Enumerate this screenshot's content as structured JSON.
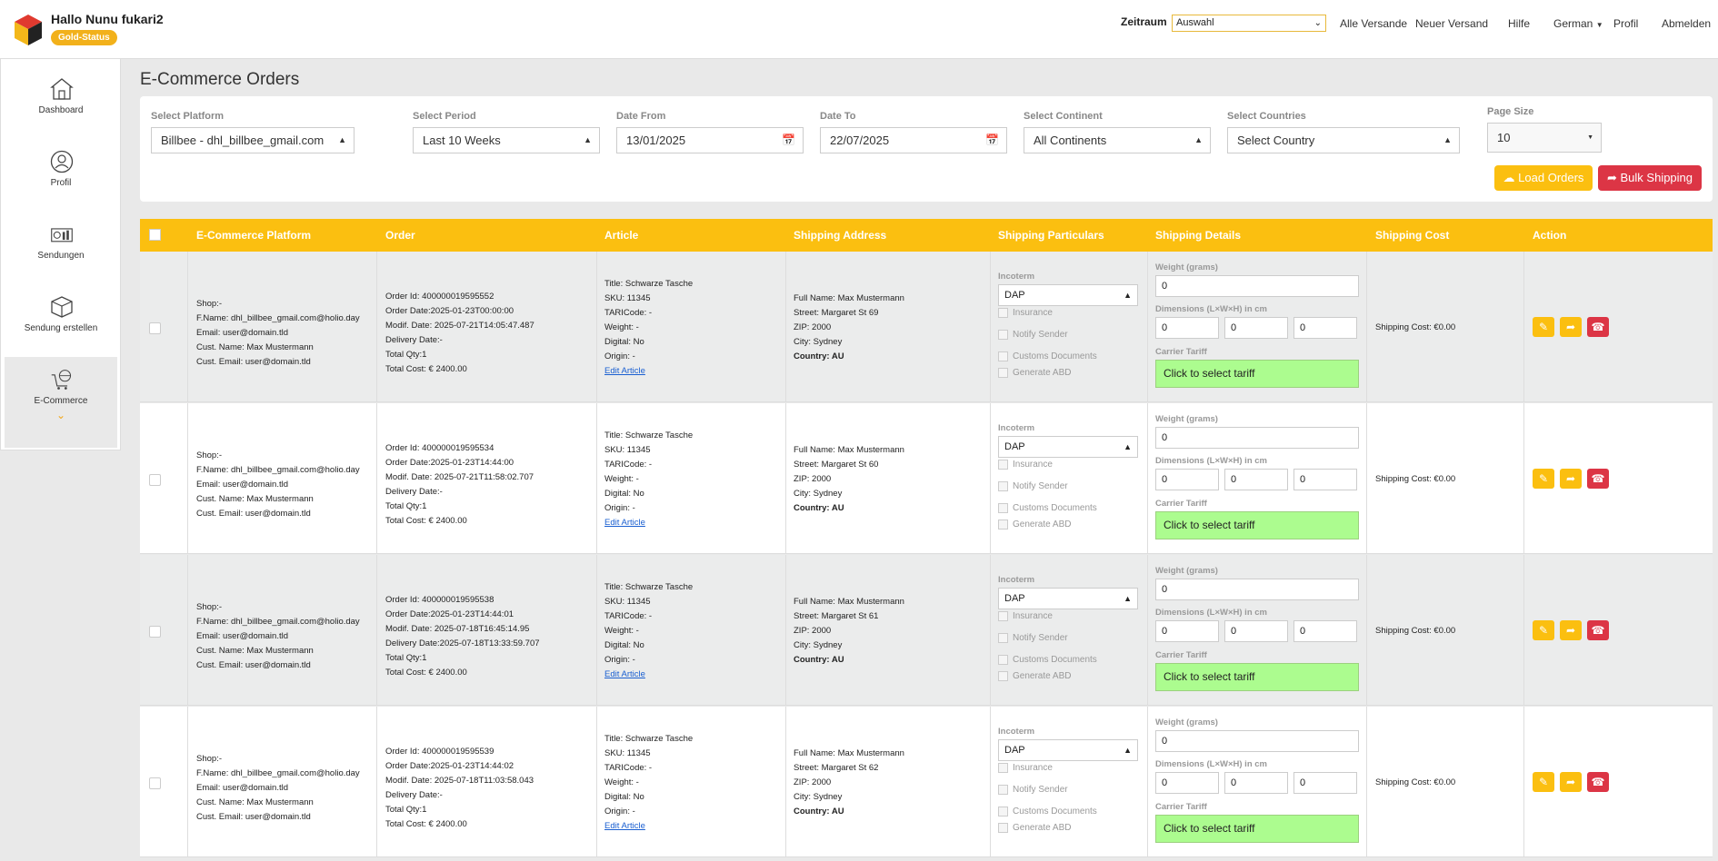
{
  "header": {
    "greeting": "Hallo Nunu fukari2",
    "status_badge": "Gold-Status",
    "zeitraum_label": "Zeitraum",
    "zeitraum_value": "Auswahl",
    "nav": [
      "Alle Versande",
      "Neuer Versand",
      "Hilfe",
      "German",
      "Profil",
      "Abmelden"
    ]
  },
  "sidebar": {
    "items": [
      {
        "label": "Dashboard",
        "icon": "house-icon"
      },
      {
        "label": "Profil",
        "icon": "user-icon"
      },
      {
        "label": "Sendungen",
        "icon": "shipments-icon"
      },
      {
        "label": "Sendung erstellen",
        "icon": "box-icon"
      },
      {
        "label": "E-Commerce",
        "icon": "cart-globe-icon"
      }
    ]
  },
  "page": {
    "title": "E-Commerce Orders"
  },
  "filters": {
    "platform_label": "Select Platform",
    "platform_value": "Billbee - dhl_billbee_gmail.com",
    "period_label": "Select Period",
    "period_value": "Last 10 Weeks",
    "date_from_label": "Date From",
    "date_from_value": "13/01/2025",
    "date_to_label": "Date To",
    "date_to_value": "22/07/2025",
    "continent_label": "Select Continent",
    "continent_value": "All Continents",
    "countries_label": "Select Countries",
    "countries_value": "Select Country",
    "page_size_label": "Page Size",
    "page_size_value": "10",
    "load_orders": "Load Orders",
    "bulk_shipping": "Bulk Shipping"
  },
  "table": {
    "headers": [
      "E-Commerce Platform",
      "Order",
      "Article",
      "Shipping Address",
      "Shipping Particulars",
      "Shipping Details",
      "Shipping Cost",
      "Action"
    ],
    "labels": {
      "incoterm": "Incoterm",
      "insurance": "Insurance",
      "notify_sender": "Notify Sender",
      "customs_documents": "Customs Documents",
      "generate_abd": "Generate ABD",
      "weight": "Weight (grams)",
      "dimensions": "Dimensions (L×W×H) in cm",
      "carrier_tariff": "Carrier Tariff",
      "tariff_button": "Click to select tariff",
      "edit_article": "Edit Article"
    },
    "rows": [
      {
        "platform": [
          "Shop:-",
          "F.Name: dhl_billbee_gmail.com@holio.day",
          "Email: user@domain.tld",
          "Cust. Name: Max Mustermann",
          "Cust. Email: user@domain.tld"
        ],
        "order": [
          "Order Id: 400000019595552",
          "Order Date:2025-01-23T00:00:00",
          "Modif. Date: 2025-07-21T14:05:47.487",
          "Delivery Date:-",
          "Total Qty:1",
          "Total Cost: € 2400.00"
        ],
        "article": [
          "Title: Schwarze Tasche",
          "SKU: 11345",
          "TARICode: -",
          "Weight: -",
          "Digital: No",
          "Origin: -"
        ],
        "address": [
          "Full Name: Max Mustermann",
          "Street: Margaret St 69",
          "ZIP: 2000",
          "City: Sydney"
        ],
        "country": "Country: AU",
        "incoterm": "DAP",
        "weight": "0",
        "dims": [
          "0",
          "0",
          "0"
        ],
        "cost": "Shipping Cost: €0.00"
      },
      {
        "platform": [
          "Shop:-",
          "F.Name: dhl_billbee_gmail.com@holio.day",
          "Email: user@domain.tld",
          "Cust. Name: Max Mustermann",
          "Cust. Email: user@domain.tld"
        ],
        "order": [
          "Order Id: 400000019595534",
          "Order Date:2025-01-23T14:44:00",
          "Modif. Date: 2025-07-21T11:58:02.707",
          "Delivery Date:-",
          "Total Qty:1",
          "Total Cost: € 2400.00"
        ],
        "article": [
          "Title: Schwarze Tasche",
          "SKU: 11345",
          "TARICode: -",
          "Weight: -",
          "Digital: No",
          "Origin: -"
        ],
        "address": [
          "Full Name: Max Mustermann",
          "Street: Margaret St 60",
          "ZIP: 2000",
          "City: Sydney"
        ],
        "country": "Country: AU",
        "incoterm": "DAP",
        "weight": "0",
        "dims": [
          "0",
          "0",
          "0"
        ],
        "cost": "Shipping Cost: €0.00"
      },
      {
        "platform": [
          "Shop:-",
          "F.Name: dhl_billbee_gmail.com@holio.day",
          "Email: user@domain.tld",
          "Cust. Name: Max Mustermann",
          "Cust. Email: user@domain.tld"
        ],
        "order": [
          "Order Id: 400000019595538",
          "Order Date:2025-01-23T14:44:01",
          "Modif. Date: 2025-07-18T16:45:14.95",
          "Delivery Date:2025-07-18T13:33:59.707",
          "Total Qty:1",
          "Total Cost: € 2400.00"
        ],
        "article": [
          "Title: Schwarze Tasche",
          "SKU: 11345",
          "TARICode: -",
          "Weight: -",
          "Digital: No",
          "Origin: -"
        ],
        "address": [
          "Full Name: Max Mustermann",
          "Street: Margaret St 61",
          "ZIP: 2000",
          "City: Sydney"
        ],
        "country": "Country: AU",
        "incoterm": "DAP",
        "weight": "0",
        "dims": [
          "0",
          "0",
          "0"
        ],
        "cost": "Shipping Cost: €0.00"
      },
      {
        "platform": [
          "Shop:-",
          "F.Name: dhl_billbee_gmail.com@holio.day",
          "Email: user@domain.tld",
          "Cust. Name: Max Mustermann",
          "Cust. Email: user@domain.tld"
        ],
        "order": [
          "Order Id: 400000019595539",
          "Order Date:2025-01-23T14:44:02",
          "Modif. Date: 2025-07-18T11:03:58.043",
          "Delivery Date:-",
          "Total Qty:1",
          "Total Cost: € 2400.00"
        ],
        "article": [
          "Title: Schwarze Tasche",
          "SKU: 11345",
          "TARICode: -",
          "Weight: -",
          "Digital: No",
          "Origin: -"
        ],
        "address": [
          "Full Name: Max Mustermann",
          "Street: Margaret St 62",
          "ZIP: 2000",
          "City: Sydney"
        ],
        "country": "Country: AU",
        "incoterm": "DAP",
        "weight": "0",
        "dims": [
          "0",
          "0",
          "0"
        ],
        "cost": "Shipping Cost: €0.00"
      }
    ]
  },
  "colors": {
    "accent": "#fbbf10",
    "danger": "#dc3545",
    "tariff_green": "#acfc8f",
    "link": "#1a5fd1"
  }
}
